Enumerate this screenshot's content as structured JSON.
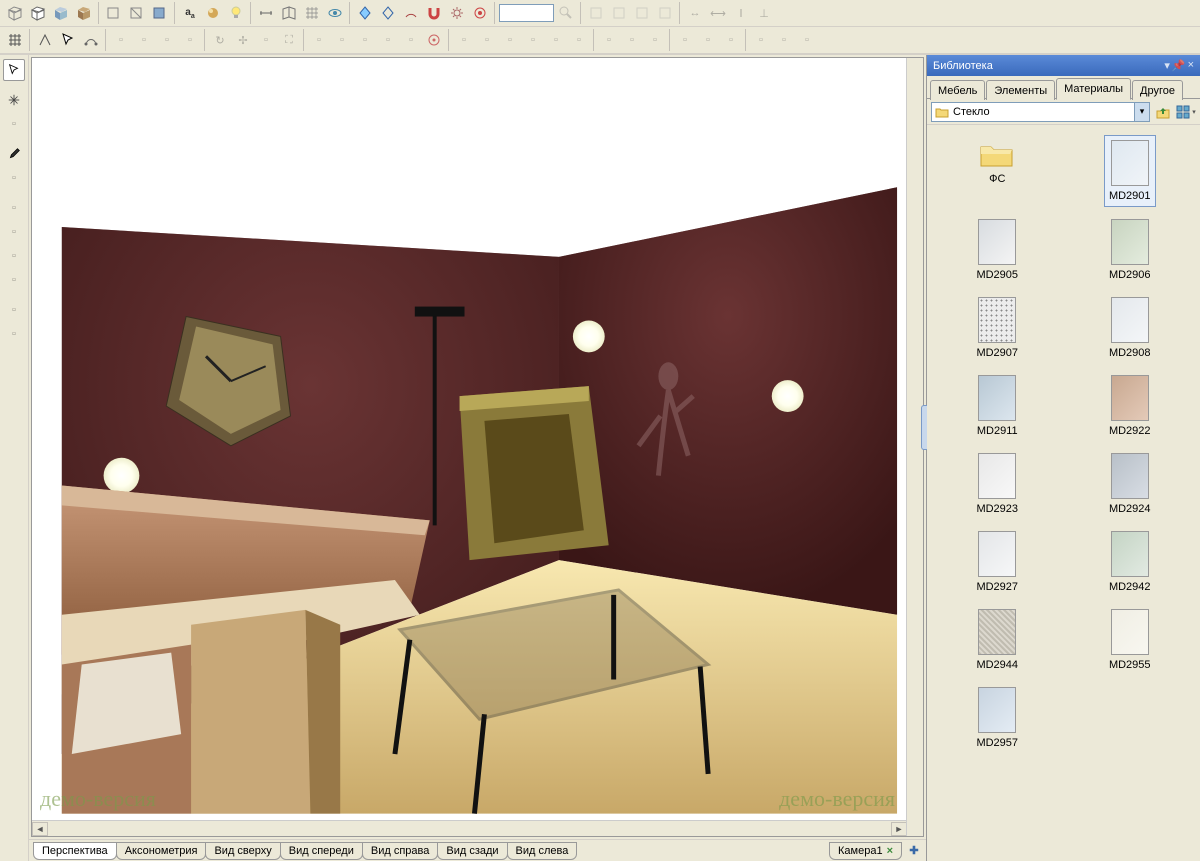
{
  "watermark": "демо-версия",
  "view_tabs": [
    "Перспектива",
    "Аксонометрия",
    "Вид сверху",
    "Вид спереди",
    "Вид справа",
    "Вид сзади",
    "Вид слева"
  ],
  "active_view_tab": 0,
  "camera_tab": "Камера1",
  "library": {
    "panel_title": "Библиотека",
    "tabs": [
      "Мебель",
      "Элементы",
      "Материалы",
      "Другое"
    ],
    "active_tab": 2,
    "combo_value": "Стекло",
    "items": [
      {
        "label": "ФС",
        "type": "folder"
      },
      {
        "label": "MD2901",
        "type": "mat",
        "selected": true,
        "c1": "#dfe8f0",
        "c2": "#f0f4f8"
      },
      {
        "label": "MD2905",
        "type": "mat",
        "c1": "#d8dce0",
        "c2": "#f4f4f4"
      },
      {
        "label": "MD2906",
        "type": "mat",
        "c1": "#c8d4c0",
        "c2": "#e4ecde"
      },
      {
        "label": "MD2907",
        "type": "mat",
        "c1": "#d8d8d8",
        "c2": "#ececec",
        "dots": true
      },
      {
        "label": "MD2908",
        "type": "mat",
        "c1": "#e4e8ec",
        "c2": "#f4f6f8"
      },
      {
        "label": "MD2911",
        "type": "mat",
        "c1": "#b8c8d4",
        "c2": "#dce6ee"
      },
      {
        "label": "MD2922",
        "type": "mat",
        "c1": "#c8a890",
        "c2": "#e4cab8"
      },
      {
        "label": "MD2923",
        "type": "mat",
        "c1": "#e8e8e8",
        "c2": "#f8f8f8"
      },
      {
        "label": "MD2924",
        "type": "mat",
        "c1": "#b8c0c8",
        "c2": "#d8dde4"
      },
      {
        "label": "MD2927",
        "type": "mat",
        "c1": "#e4e6e8",
        "c2": "#f6f7f8"
      },
      {
        "label": "MD2942",
        "type": "mat",
        "c1": "#c4d4c4",
        "c2": "#e2eae2"
      },
      {
        "label": "MD2944",
        "type": "mat",
        "c1": "#c0bcb0",
        "c2": "#dcd8ce",
        "tex": true
      },
      {
        "label": "MD2955",
        "type": "mat",
        "c1": "#f0eee4",
        "c2": "#f8f7f0"
      },
      {
        "label": "MD2957",
        "type": "mat",
        "c1": "#c8d4e0",
        "c2": "#e4ecf4"
      }
    ]
  }
}
